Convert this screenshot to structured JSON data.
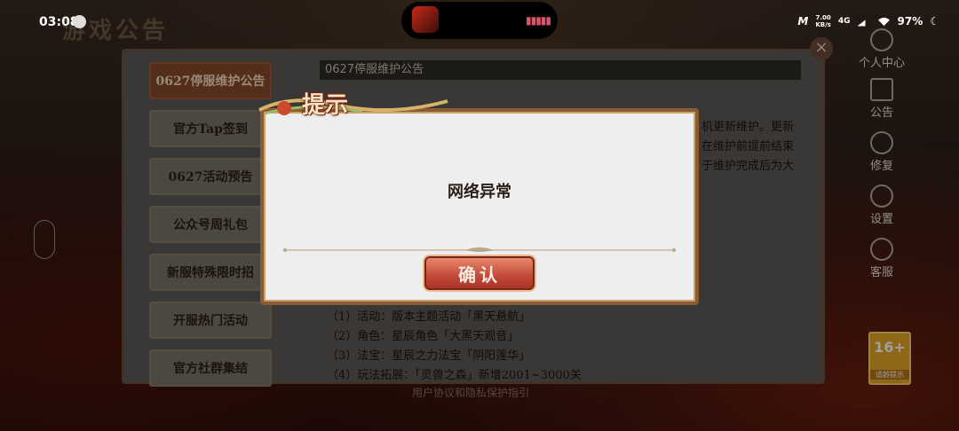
{
  "status_bar": {
    "time": "03:08",
    "speed": "7.00\nKB/s",
    "network": "4G",
    "battery": "97%"
  },
  "banner": {
    "title": "游戏公告"
  },
  "tabs": [
    {
      "label": "0627停服维护公告",
      "active": true
    },
    {
      "label": "官方Tap签到"
    },
    {
      "label": "0627活动预告"
    },
    {
      "label": "公众号周礼包"
    },
    {
      "label": "新服特殊限时招"
    },
    {
      "label": "开服热门活动"
    },
    {
      "label": "官方社群集结"
    }
  ],
  "content": {
    "heading": "0627停服维护公告",
    "fragments": [
      "机更新维护。更新",
      "在维护前提前结束",
      "于维护完成后为大"
    ],
    "lines": [
      "（1）活动：版本主题活动「黑天悬航」",
      "（2）角色：星辰角色「大黑天观音」",
      "（3）法宝：星辰之力法宝「阴阳莲华」",
      "（4）玩法拓展：「灵兽之森」新增2001~3000关"
    ]
  },
  "footer": {
    "link": "用户协议和隐私保护指引"
  },
  "side_menu": [
    {
      "label": "个人中心",
      "icon": "user-icon"
    },
    {
      "label": "公告",
      "icon": "notice-icon"
    },
    {
      "label": "修复",
      "icon": "repair-icon"
    },
    {
      "label": "设置",
      "icon": "gear-icon"
    },
    {
      "label": "客服",
      "icon": "service-icon"
    }
  ],
  "age_rating": {
    "num": "16+",
    "text": "适龄提示"
  },
  "dialog": {
    "title": "提示",
    "message": "网络异常",
    "confirm_label": "确认"
  },
  "colors": {
    "dialog_bg": "#efeeee",
    "confirm_btn": "#c4493a",
    "active_tab": "#8a4a2c",
    "age_badge": "#e6a626"
  }
}
